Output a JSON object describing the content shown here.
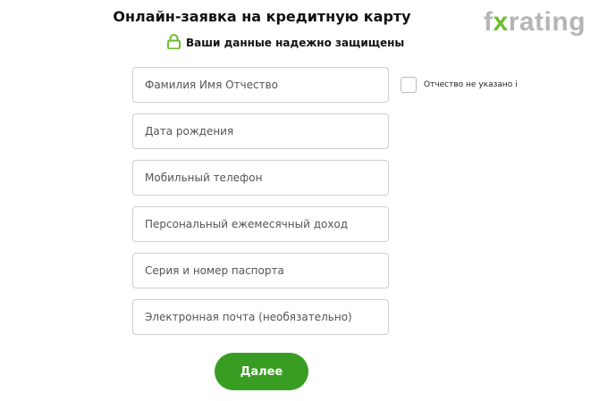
{
  "page": {
    "title": "Онлайн-заявка на кредитную карту",
    "secure_note": "Ваши данные надежно защищены"
  },
  "logo": {
    "text_before": "f",
    "text_x": "x",
    "text_after": "rating"
  },
  "form": {
    "full_name_placeholder": "Фамилия Имя Отчество",
    "no_patronymic_label": "Отчество не указано і",
    "birth_date_placeholder": "Дата рождения",
    "phone_placeholder": "Мобильный телефон",
    "income_placeholder": "Персональный ежемесячный доход",
    "passport_placeholder": "Серия и номер паспорта",
    "email_placeholder": "Электронная почта (необязательно)",
    "submit_label": "Далее"
  },
  "colors": {
    "accent": "#3a9d23",
    "lock_icon": "#6dbf2f",
    "logo_gray": "#b5b5b5",
    "field_border": "#cfcfcf"
  }
}
